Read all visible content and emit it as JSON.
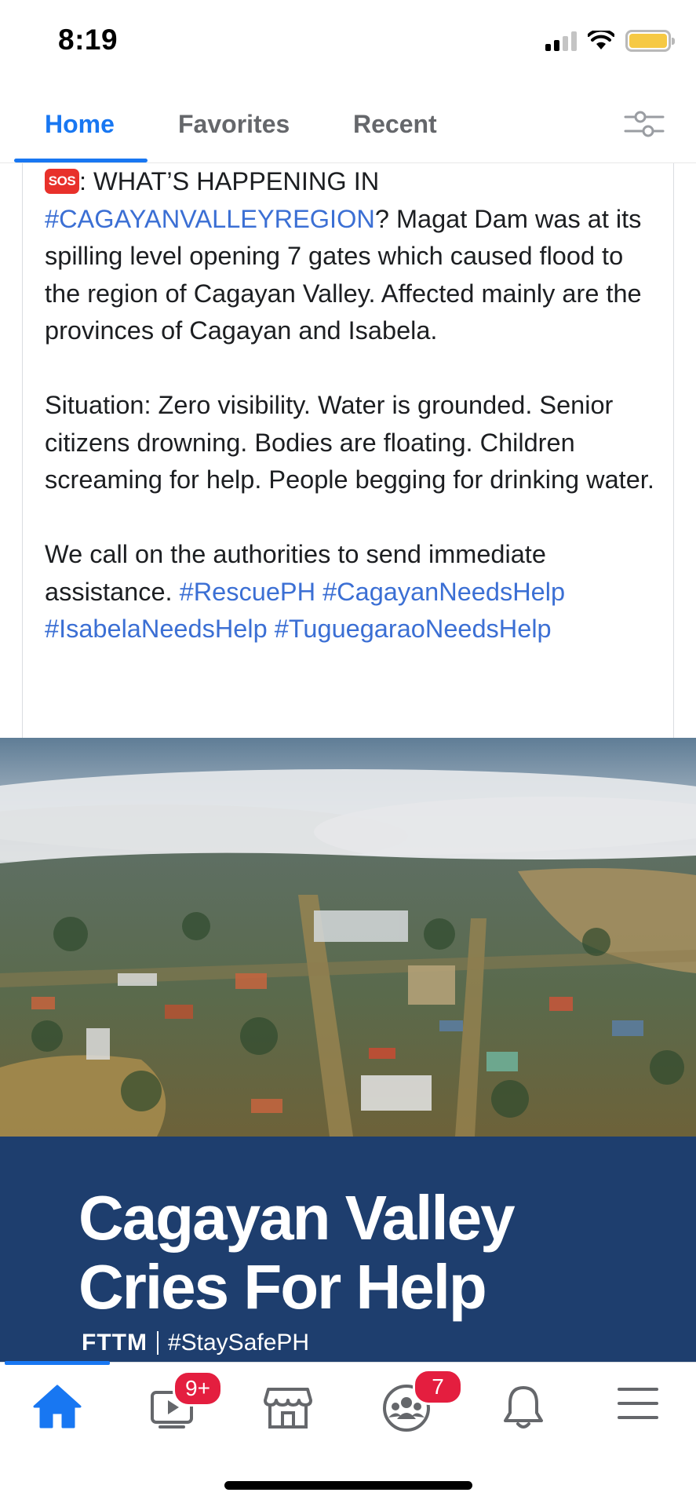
{
  "status_bar": {
    "time": "8:19",
    "battery_color": "#f6c944",
    "icons": [
      "cellular-signal-icon",
      "wifi-icon",
      "battery-icon"
    ]
  },
  "tabs": [
    {
      "label": "Home",
      "active": true
    },
    {
      "label": "Favorites",
      "active": false
    },
    {
      "label": "Recent",
      "active": false
    }
  ],
  "post": {
    "sos_label": "SOS",
    "p1_lead": ": WHAT’S HAPPENING IN",
    "p1_tag": "#CAGAYANVALLEYREGION",
    "p1_rest": "? Magat Dam was at its spilling level opening 7 gates which caused flood to the region of Cagayan Valley. Affected mainly are the provinces of Cagayan and Isabela.",
    "p2": "Situation: Zero visibility. Water is grounded. Senior citizens drowning. Bodies are floating. Children screaming for help. People begging for drinking water.",
    "p3_lead": "We call on the authorities to send immediate assistance.",
    "hashtags": [
      "#RescuePH",
      "#CagayanNeedsHelp",
      "#IsabelaNeedsHelp",
      "#TuguegaraoNeedsHelp"
    ]
  },
  "image": {
    "banner_line1": "Cagayan Valley",
    "banner_line2": "Cries For Help",
    "brand": "FTTM",
    "tagline": "#StaySafePH"
  },
  "bottom_nav": {
    "items": [
      {
        "icon": "home-icon",
        "active": true
      },
      {
        "icon": "watch-video-icon",
        "badge": "9+"
      },
      {
        "icon": "marketplace-icon"
      },
      {
        "icon": "groups-icon",
        "badge": "7"
      },
      {
        "icon": "notifications-bell-icon"
      },
      {
        "icon": "menu-icon"
      }
    ]
  },
  "colors": {
    "accent": "#1877f2",
    "hashtag": "#3b6fd4",
    "banner": "#1e3e6e",
    "badge": "#e41e3f"
  }
}
